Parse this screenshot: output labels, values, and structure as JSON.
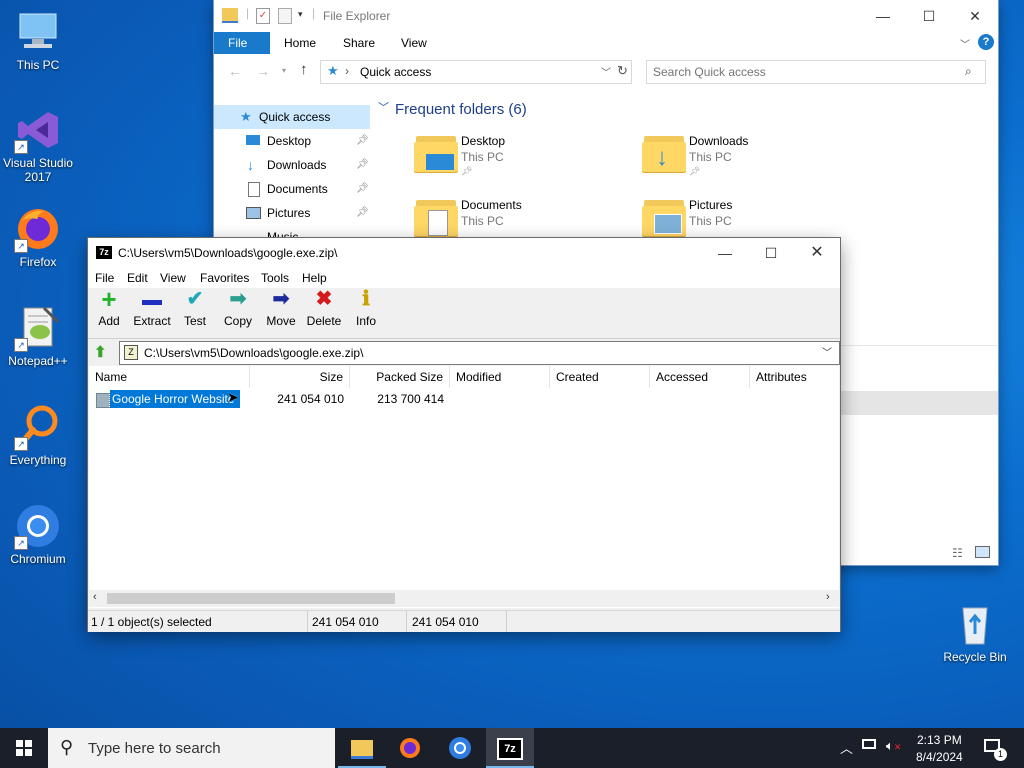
{
  "desktop": {
    "icons": [
      {
        "label": "This PC"
      },
      {
        "label": "Visual Studio\n2017"
      },
      {
        "label": "Firefox"
      },
      {
        "label": "Notepad++"
      },
      {
        "label": "Everything"
      },
      {
        "label": "Chromium"
      },
      {
        "label": "Recycle Bin"
      }
    ]
  },
  "explorer": {
    "title": "File Explorer",
    "tabs": [
      "File",
      "Home",
      "Share",
      "View"
    ],
    "address": "Quick access",
    "search_placeholder": "Search Quick access",
    "nav": [
      "Quick access",
      "Desktop",
      "Downloads",
      "Documents",
      "Pictures",
      "Music"
    ],
    "section_title": "Frequent folders (6)",
    "folders": [
      {
        "name": "Desktop",
        "location": "This PC"
      },
      {
        "name": "Downloads",
        "location": "This PC"
      },
      {
        "name": "Documents",
        "location": "This PC"
      },
      {
        "name": "Pictures",
        "location": "This PC"
      }
    ]
  },
  "sevenzip": {
    "title": "C:\\Users\\vm5\\Downloads\\google.exe.zip\\",
    "app_icon_text": "7z",
    "menu": [
      "File",
      "Edit",
      "View",
      "Favorites",
      "Tools",
      "Help"
    ],
    "toolbar": [
      "Add",
      "Extract",
      "Test",
      "Copy",
      "Move",
      "Delete",
      "Info"
    ],
    "path": "C:\\Users\\vm5\\Downloads\\google.exe.zip\\",
    "columns": [
      "Name",
      "Size",
      "Packed Size",
      "Modified",
      "Created",
      "Accessed",
      "Attributes"
    ],
    "rows": [
      {
        "name": "Google Horror Website",
        "size": "241 054 010",
        "packed": "213 700 414",
        "modified": "",
        "created": "",
        "accessed": "",
        "attributes": ""
      }
    ],
    "status": {
      "selection": "1 / 1 object(s) selected",
      "size": "241 054 010",
      "packed": "241 054 010"
    }
  },
  "taskbar": {
    "search_placeholder": "Type here to search",
    "time": "2:13 PM",
    "date": "8/4/2024",
    "notification_count": "1"
  }
}
